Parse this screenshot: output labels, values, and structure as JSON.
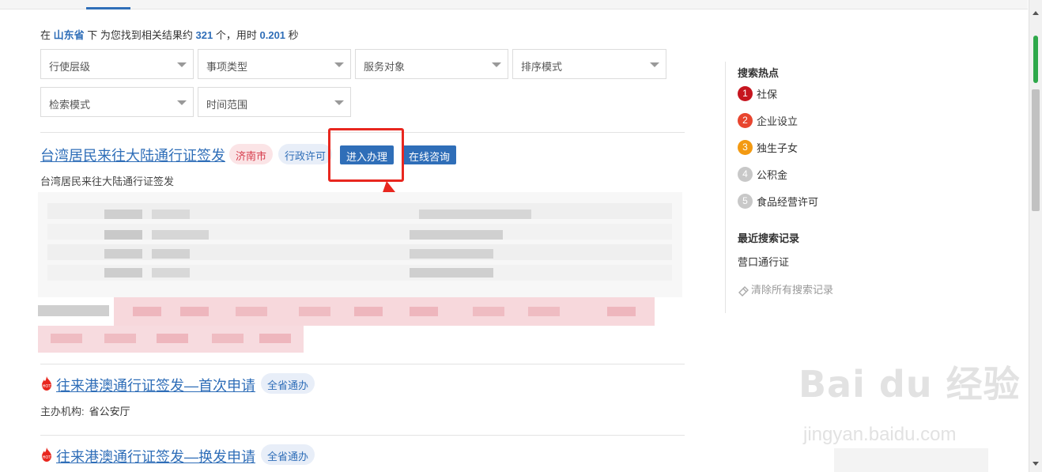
{
  "summary": {
    "prefix": "在",
    "region": "山东省",
    "mid1": "下 为您找到相关结果约",
    "count": "321",
    "mid2": "个，用时",
    "time": "0.201",
    "suffix": "秒"
  },
  "filters": [
    {
      "label": "行使层级"
    },
    {
      "label": "事项类型"
    },
    {
      "label": "服务对象"
    },
    {
      "label": "排序模式"
    },
    {
      "label": "检索模式"
    },
    {
      "label": "时间范围"
    }
  ],
  "results": [
    {
      "title": "台湾居民来往大陆通行证签发",
      "tag_city": "济南市",
      "tag_type": "行政许可",
      "btn_handle": "进入办理",
      "btn_consult": "在线咨询",
      "desc": "台湾居民来往大陆通行证签发"
    },
    {
      "title": "往来港澳通行证签发—首次申请",
      "tag": "全省通办",
      "org_label": "主办机构:",
      "org_value": "省公安厅",
      "hot_icon_text": "HOT"
    },
    {
      "title": "往来港澳通行证签发—换发申请",
      "tag": "全省通办",
      "hot_icon_text": "HOT"
    }
  ],
  "sidebar": {
    "hot_title": "搜索热点",
    "hot_items": [
      {
        "num": "1",
        "label": "社保",
        "color": "#c6151f"
      },
      {
        "num": "2",
        "label": "企业设立",
        "color": "#e8452f"
      },
      {
        "num": "3",
        "label": "独生子女",
        "color": "#f39a12"
      },
      {
        "num": "4",
        "label": "公积金",
        "color": "#c8c8c8"
      },
      {
        "num": "5",
        "label": "食品经营许可",
        "color": "#c8c8c8"
      }
    ],
    "recent_title": "最近搜索记录",
    "recent_items": [
      "营口通行证"
    ],
    "clear_label": "清除所有搜索记录"
  },
  "watermark": {
    "brand": "Bai du 经验",
    "url": "jingyan.baidu.com"
  },
  "colors": {
    "accent": "#2f6eb8",
    "annotation_red": "#e8271f"
  }
}
